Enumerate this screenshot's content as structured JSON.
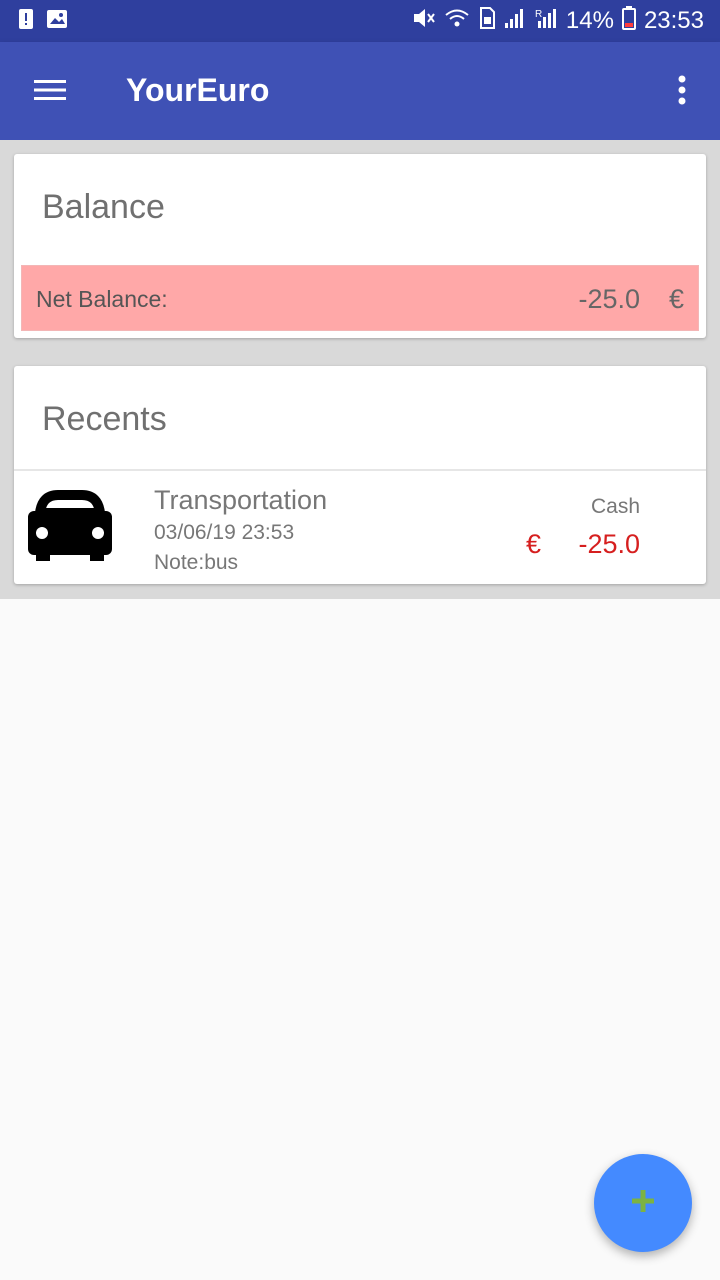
{
  "status_bar": {
    "battery_percent": "14%",
    "time": "23:53",
    "left_icons": [
      "alert-icon",
      "image-icon"
    ],
    "right_icons": [
      "mute-icon",
      "wifi-icon",
      "sim-icon",
      "signal-icon",
      "signal-r-icon",
      "battery-icon"
    ]
  },
  "app_bar": {
    "title": "YourEuro",
    "menu_icon": "hamburger-icon",
    "more_icon": "more-vert-icon",
    "color": "#3f51b5"
  },
  "balance": {
    "title": "Balance",
    "net_label": "Net Balance:",
    "net_value": "-25.0",
    "currency": "€",
    "highlight_color": "#ffa8a8"
  },
  "recents": {
    "title": "Recents",
    "items": [
      {
        "icon": "car-icon",
        "category": "Transportation",
        "datetime": "03/06/19 23:53",
        "note": "Note:bus",
        "method": "Cash",
        "currency": "€",
        "amount": "-25.0",
        "amount_color": "#d61f1f"
      }
    ]
  },
  "fab": {
    "icon": "plus-icon",
    "color": "#448aff",
    "icon_color": "#7cb342"
  }
}
